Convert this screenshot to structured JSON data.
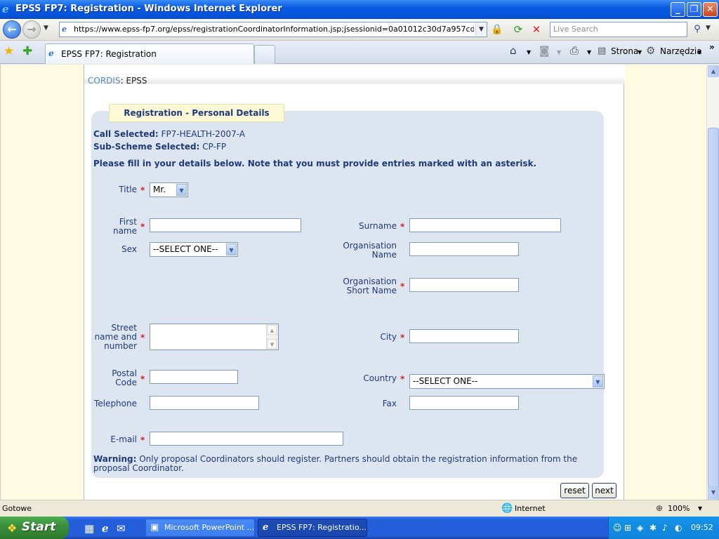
{
  "window": {
    "title": "EPSS FP7: Registration - Windows Internet Explorer",
    "minimize": "_",
    "maximize": "❐",
    "close": "✕"
  },
  "nav": {
    "url": "https://www.epss-fp7.org/epss/registrationCoordinatorInformation.jsp;jsessionid=0a01012c30d7a957cd0fdc724bfca",
    "search_placeholder": "Live Search"
  },
  "tabs": {
    "active_label": "EPSS FP7: Registration"
  },
  "commandbar": {
    "page_label": "Strona",
    "tools_label": "Narzędzia"
  },
  "page": {
    "breadcrumb": {
      "cordis": "CORDIS",
      "separator": ":",
      "epss": "EPSS"
    },
    "header": "Registration - Personal Details",
    "call_label": "Call Selected:",
    "call_value": "FP7-HEALTH-2007-A",
    "subscheme_label": "Sub-Scheme Selected:",
    "subscheme_value": "CP-FP",
    "instructions": "Please fill in your details below. Note that you must provide entries marked with an asterisk.",
    "required_marker": "*",
    "fields": {
      "title": {
        "label": "Title",
        "value": "Mr."
      },
      "first_name": {
        "label_line1": "First",
        "label_line2": "name"
      },
      "surname": {
        "label": "Surname"
      },
      "sex": {
        "label": "Sex",
        "value": "--SELECT ONE--"
      },
      "org_name": {
        "label_line1": "Organisation",
        "label_line2": "Name"
      },
      "org_short": {
        "label_line1": "Organisation",
        "label_line2": "Short Name"
      },
      "street": {
        "label_line1": "Street",
        "label_line2": "name and",
        "label_line3": "number"
      },
      "city": {
        "label": "City"
      },
      "postal": {
        "label_line1": "Postal",
        "label_line2": "Code"
      },
      "country": {
        "label": "Country",
        "value": "--SELECT ONE--"
      },
      "telephone": {
        "label": "Telephone"
      },
      "fax": {
        "label": "Fax"
      },
      "email": {
        "label": "E-mail"
      }
    },
    "warning_label": "Warning:",
    "warning_text": " Only proposal Coordinators should register. Partners should obtain the registration information from the proposal Coordinator.",
    "reset_label": "reset",
    "next_label": "next"
  },
  "status": {
    "text": "Gotowe",
    "zone": "Internet",
    "zoom": "100%"
  },
  "taskbar": {
    "start_label": "Start",
    "task1_label": "Microsoft PowerPoint ...",
    "task2_label": "EPSS FP7: Registratio...",
    "clock": "09:52"
  }
}
